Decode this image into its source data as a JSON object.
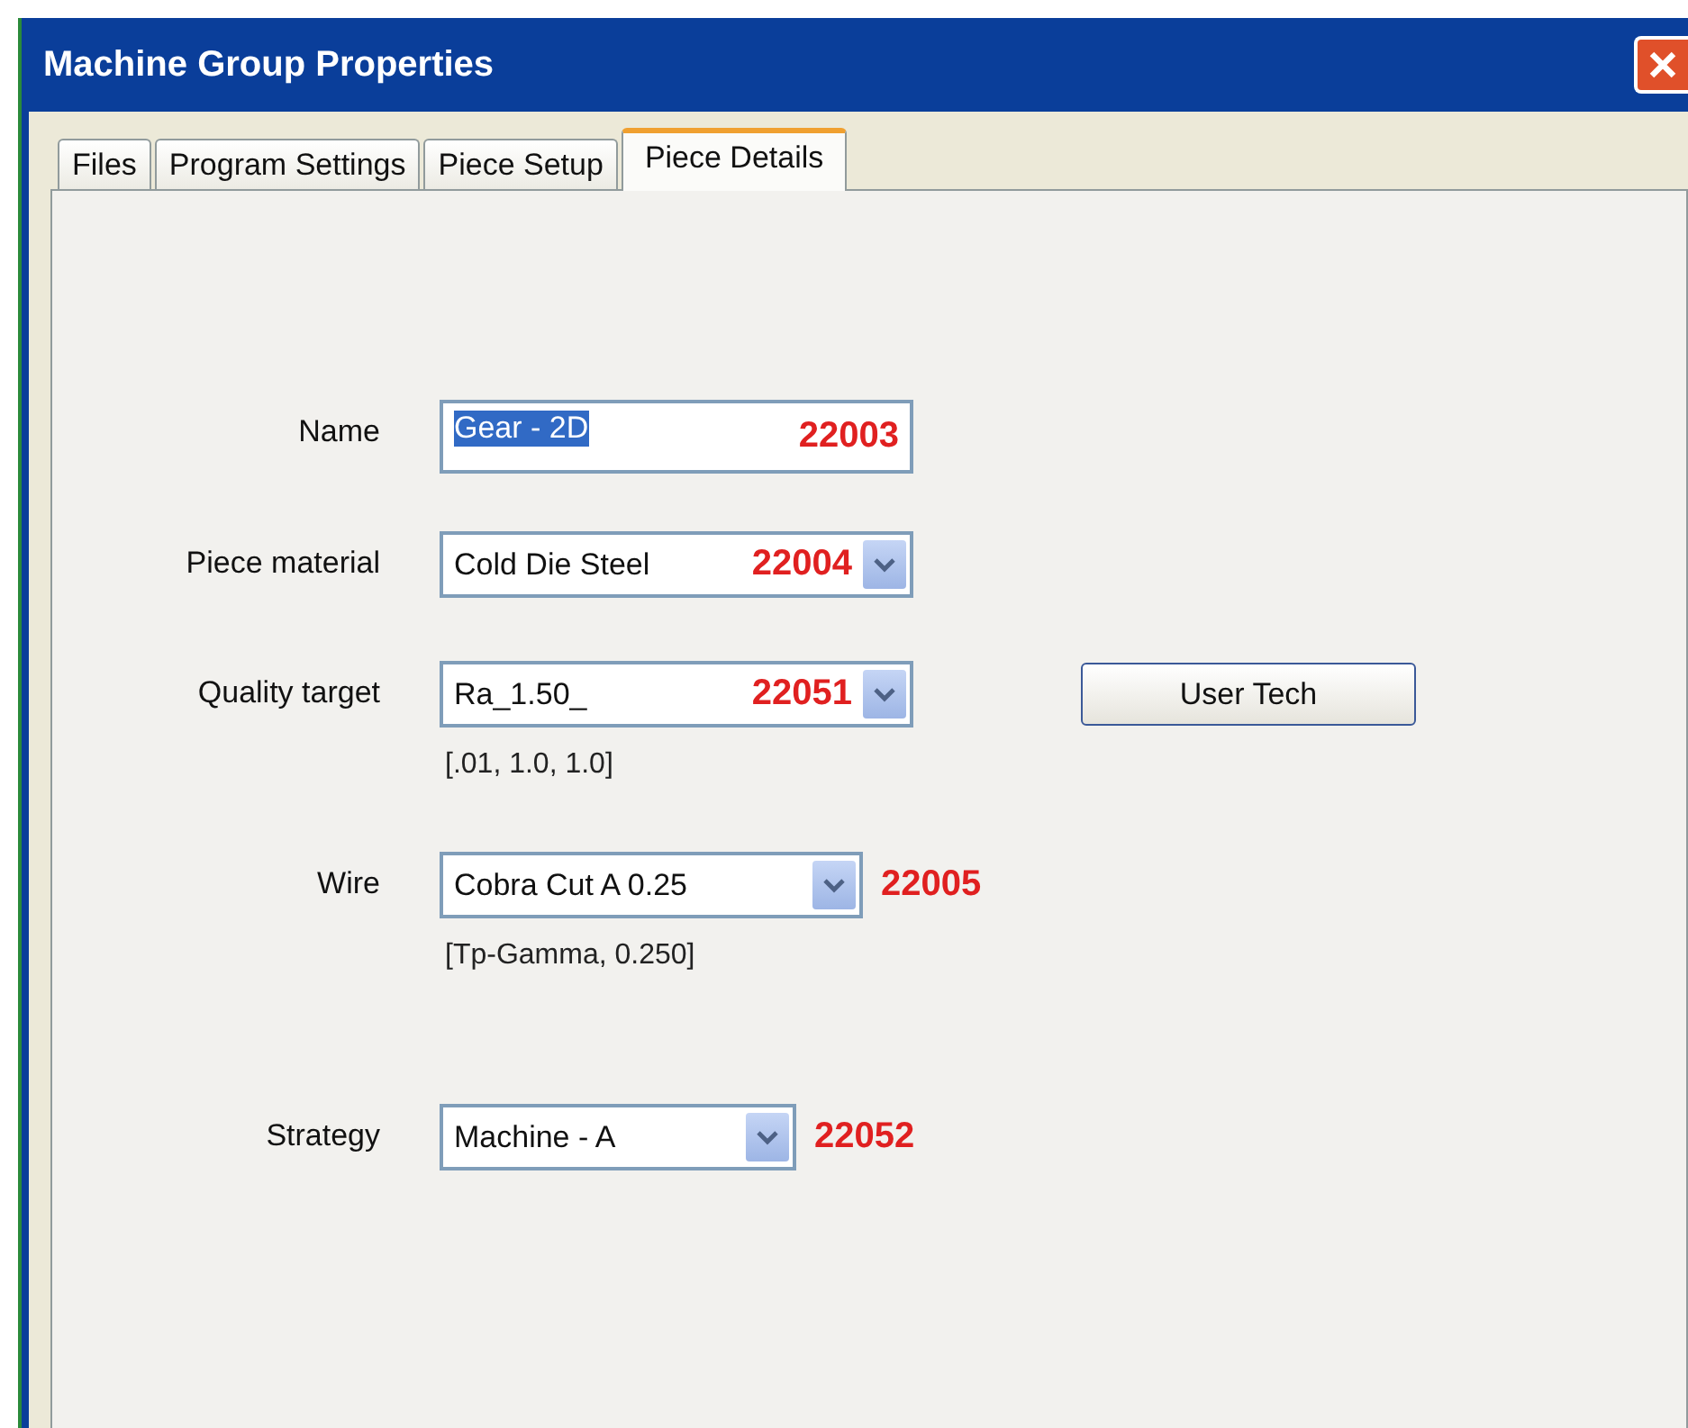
{
  "window": {
    "title": "Machine Group Properties"
  },
  "tabs": [
    {
      "label": "Files",
      "selected": false
    },
    {
      "label": "Program Settings",
      "selected": false
    },
    {
      "label": "Piece Setup",
      "selected": false
    },
    {
      "label": "Piece Details",
      "selected": true
    }
  ],
  "fields": [
    {
      "label": "Name",
      "kind": "text",
      "value": "Gear - 2D",
      "value_selected": true,
      "annotation": "22003",
      "annotation_inside": true
    },
    {
      "label": "Piece material",
      "kind": "combo",
      "value": "Cold Die Steel",
      "annotation": "22004",
      "annotation_inside": true
    },
    {
      "label": "Quality target",
      "kind": "combo",
      "value": "Ra_1.50_",
      "annotation": "22051",
      "annotation_inside": true,
      "hint": "[.01, 1.0, 1.0]",
      "button": "User Tech"
    },
    {
      "label": "Wire",
      "kind": "combo",
      "value": "Cobra Cut A 0.25",
      "annotation": "22005",
      "annotation_inside": false,
      "hint": "[Tp-Gamma, 0.250]"
    },
    {
      "label": "Strategy",
      "kind": "combo",
      "value": "Machine - A",
      "annotation": "22052",
      "annotation_inside": false
    }
  ]
}
